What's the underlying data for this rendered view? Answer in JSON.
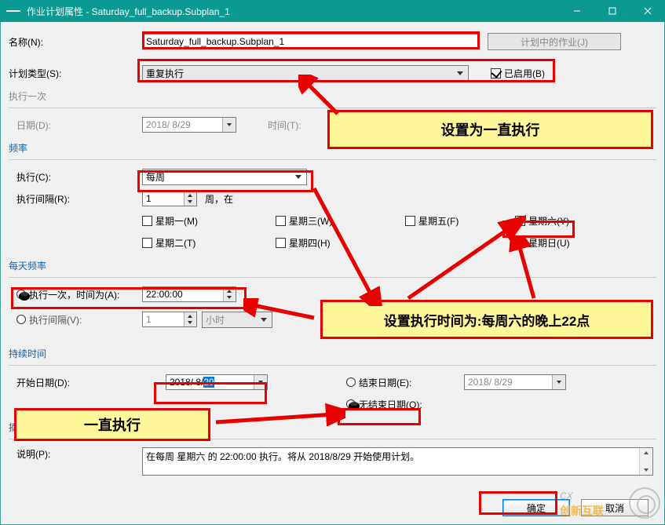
{
  "window": {
    "title": "作业计划属性 - Saturday_full_backup.Subplan_1"
  },
  "fields": {
    "name_label": "名称(N):",
    "name_value": "Saturday_full_backup.Subplan_1",
    "jobs_btn": "计划中的作业(J)",
    "type_label": "计划类型(S):",
    "type_value": "重复执行",
    "enabled_label": "已启用(B)",
    "once_section": "执行一次",
    "date_label": "日期(D):",
    "date_value": "2018/ 8/29",
    "time_label": "时间(T):",
    "freq_section": "频率",
    "exec_label": "执行(C):",
    "exec_value": "每周",
    "interval_label": "执行间隔(R):",
    "interval_value": "1",
    "interval_unit": "周，在",
    "mon": "星期一(M)",
    "tue": "星期二(T)",
    "wed": "星期三(W)",
    "thu": "星期四(H)",
    "fri": "星期五(F)",
    "sat": "星期六(Y)",
    "sun": "星期日(U)",
    "dayfreq_section": "每天频率",
    "once_at_label": "执行一次，时间为(A):",
    "once_at_value": "22:00:00",
    "interval_at_label": "执行间隔(V):",
    "interval_at_value": "1",
    "interval_at_unit": "小时",
    "duration_section": "持续时间",
    "start_date_label": "开始日期(D):",
    "start_date_value": "2018/ 8/29",
    "end_date_label": "结束日期(E):",
    "end_date_value": "2018/ 8/29",
    "no_end_label": "无结束日期(O):",
    "summary_section": "摘要",
    "desc_label": "说明(P):",
    "desc_value": "在每周 星期六 的 22:00:00 执行。将从 2018/8/29 开始使用计划。",
    "ok_btn": "确定",
    "cancel_btn": "取消"
  },
  "annotations": {
    "c1": "设置为一直执行",
    "c2": "设置执行时间为:每周六的晚上22点",
    "c3": "一直执行"
  },
  "watermark": {
    "t1": "CX",
    "t2": "创新互联"
  }
}
